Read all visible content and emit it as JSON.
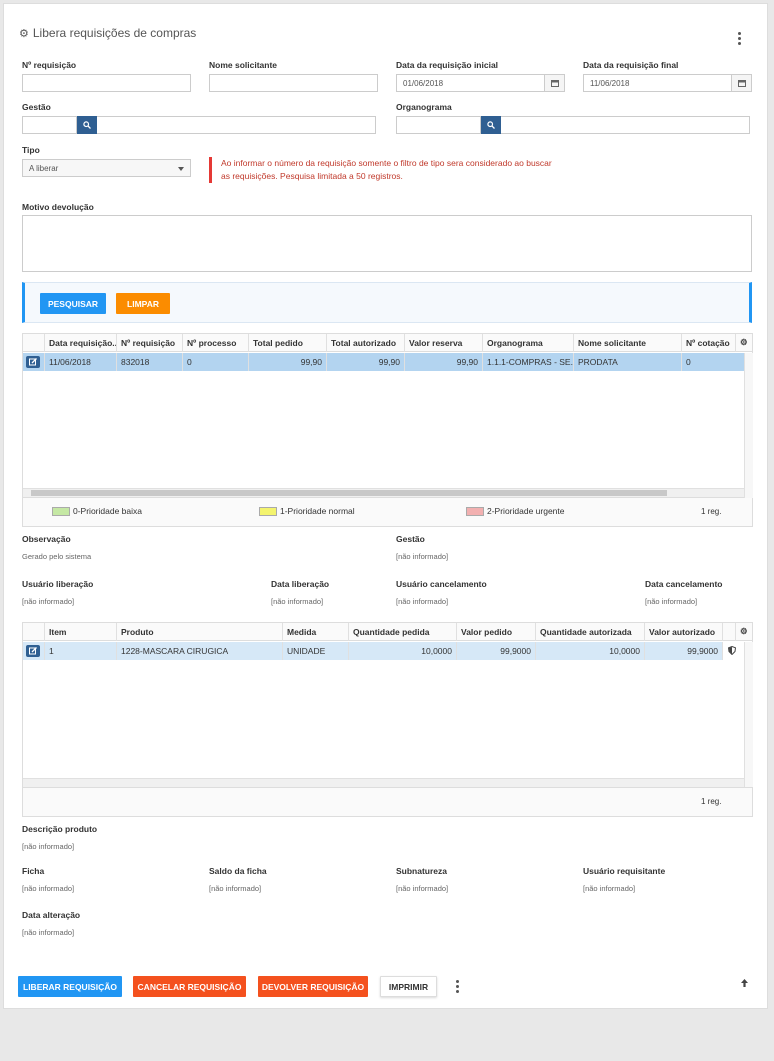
{
  "title": "Libera requisições de compras",
  "fields": {
    "numero_req_label": "Nº requisição",
    "nome_solicitante_label": "Nome solicitante",
    "data_inicial_label": "Data da requisição inicial",
    "data_inicial_value": "01/06/2018",
    "data_final_label": "Data da requisição final",
    "data_final_value": "11/06/2018",
    "gestao_label": "Gestão",
    "organograma_label": "Organograma",
    "tipo_label": "Tipo",
    "tipo_value": "A liberar",
    "motivo_label": "Motivo devolução"
  },
  "warning": "Ao informar o número da requisição somente o filtro de tipo sera considerado ao buscar as requisições. Pesquisa limitada a 50 registros.",
  "actions": {
    "pesquisar": "PESQUISAR",
    "limpar": "LIMPAR"
  },
  "grid1": {
    "columns": [
      "Data requisição...",
      "Nº requisição",
      "Nº processo",
      "Total pedido",
      "Total autorizado",
      "Valor reserva",
      "Organograma",
      "Nome solicitante",
      "Nº cotação"
    ],
    "rows": [
      [
        "11/06/2018",
        "832018",
        "0",
        "99,90",
        "99,90",
        "99,90",
        "1.1.1-COMPRAS - SE...",
        "PRODATA",
        "0"
      ]
    ],
    "count": "1 reg."
  },
  "legend": [
    {
      "label": "0-Prioridade baixa",
      "color": "#c5e8a4"
    },
    {
      "label": "1-Prioridade normal",
      "color": "#f4f46e"
    },
    {
      "label": "2-Prioridade urgente",
      "color": "#f2b0b0"
    }
  ],
  "details1": {
    "observacao_label": "Observação",
    "observacao_value": "Gerado pelo sistema",
    "gestao_label": "Gestão",
    "gestao_value": "[não informado]",
    "usuario_lib_label": "Usuário liberação",
    "usuario_lib_value": "[não informado]",
    "data_lib_label": "Data liberação",
    "data_lib_value": "[não informado]",
    "usuario_canc_label": "Usuário cancelamento",
    "usuario_canc_value": "[não informado]",
    "data_canc_label": "Data cancelamento",
    "data_canc_value": "[não informado]"
  },
  "grid2": {
    "columns": [
      "Item",
      "Produto",
      "Medida",
      "Quantidade pedida",
      "Valor pedido",
      "Quantidade autorizada",
      "Valor autorizado"
    ],
    "rows": [
      [
        "1",
        "1228-MASCARA CIRUGICA",
        "UNIDADE",
        "10,0000",
        "99,9000",
        "10,0000",
        "99,9000"
      ]
    ],
    "count": "1 reg."
  },
  "details2": {
    "descricao_label": "Descrição produto",
    "descricao_value": "[não informado]",
    "ficha_label": "Ficha",
    "ficha_value": "[não informado]",
    "saldo_label": "Saldo da ficha",
    "saldo_value": "[não informado]",
    "subnatureza_label": "Subnatureza",
    "subnatureza_value": "[não informado]",
    "usuario_req_label": "Usuário requisitante",
    "usuario_req_value": "[não informado]",
    "data_alt_label": "Data alteração",
    "data_alt_value": "[não informado]"
  },
  "footer": {
    "liberar": "LIBERAR REQUISIÇÃO",
    "cancelar": "CANCELAR REQUISIÇÃO",
    "devolver": "DEVOLVER REQUISIÇÃO",
    "imprimir": "IMPRIMIR"
  },
  "colors": {
    "accent": "#2196f3",
    "orange": "#fb8c00",
    "danger": "#f4511e",
    "row_selected": "#b3d4f0"
  }
}
